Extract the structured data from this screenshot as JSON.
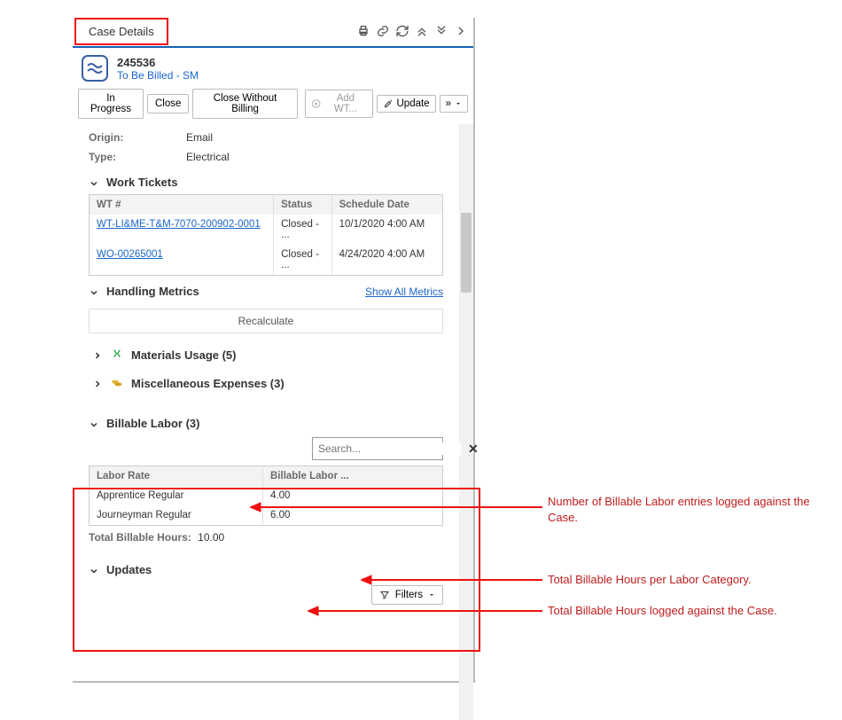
{
  "header": {
    "title": "Case Details"
  },
  "caseHead": {
    "number": "245536",
    "status": "To Be Billed - SM"
  },
  "actions": {
    "in_progress": "In Progress",
    "close": "Close",
    "close_wo_billing": "Close Without Billing",
    "add_wt": "Add WT...",
    "update": "Update",
    "more": "»"
  },
  "fields": {
    "origin_label": "Origin:",
    "origin_value": "Email",
    "type_label": "Type:",
    "type_value": "Electrical"
  },
  "workTickets": {
    "title": "Work Tickets",
    "cols": {
      "wt": "WT #",
      "status": "Status",
      "schedule": "Schedule Date"
    },
    "rows": [
      {
        "wt": "WT-LI&ME-T&M-7070-200902-0001",
        "status": "Closed - ...",
        "schedule": "10/1/2020 4:00 AM"
      },
      {
        "wt": "WO-00265001",
        "status": "Closed - ...",
        "schedule": "4/24/2020 4:00 AM"
      }
    ]
  },
  "metrics": {
    "title": "Handling Metrics",
    "show_all": "Show All Metrics",
    "recalculate": "Recalculate"
  },
  "materials": {
    "title": "Materials Usage (5)"
  },
  "misc": {
    "title": "Miscellaneous Expenses (3)"
  },
  "billable": {
    "title": "Billable Labor (3)",
    "search_placeholder": "Search...",
    "cols": {
      "rate": "Labor Rate",
      "hrs": "Billable Labor ..."
    },
    "rows": [
      {
        "rate": "Apprentice Regular",
        "hrs": "4.00"
      },
      {
        "rate": "Journeyman Regular",
        "hrs": "6.00"
      }
    ],
    "total_label": "Total Billable Hours:",
    "total_value": "10.00"
  },
  "updates": {
    "title": "Updates",
    "filters": "Filters"
  },
  "annotations": {
    "a1": "Number of Billable Labor entries logged against the Case.",
    "a2": "Total Billable Hours per Labor Category.",
    "a3": "Total Billable Hours logged against the Case."
  }
}
